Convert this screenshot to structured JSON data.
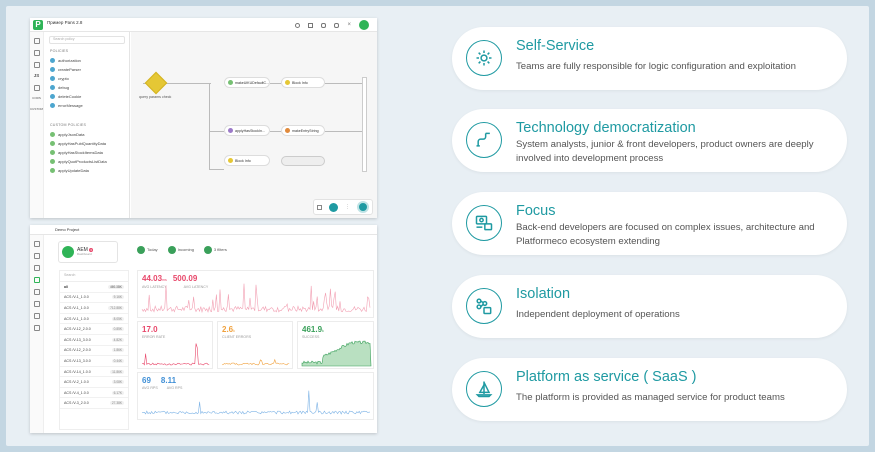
{
  "colors": {
    "accent": "#1f9aa2",
    "brand": "#2fb457",
    "pink": "#e8476a",
    "orange": "#f0a03c",
    "green": "#3aa05a",
    "blue": "#3f8fd6"
  },
  "editor": {
    "app_title": "Пример Pans 2.8",
    "search_placeholder": "Search policy",
    "policies_header": "POLICIES",
    "policies": [
      "authorization",
      "createParser",
      "crypto",
      "debug",
      "deleteCookie",
      "errorMessage"
    ],
    "custom_header": "CUSTOM POLICIES",
    "custom_policies": [
      "applyJsonData",
      "applyHasPublQuantityData",
      "applyHasStockItemsData",
      "applyQuotProductsListData",
      "applyUpdateData"
    ],
    "rail_labels": [
      "JS",
      "CORS",
      "CUSTOM"
    ],
    "nodes": {
      "query": "query params check",
      "n1": "makeUiKUDefaultC...",
      "n2": "Block Info",
      "n3": "applyHasStockIn...",
      "n4": "makeEntryString",
      "n5": "Block Info"
    }
  },
  "monitor": {
    "project": "Demo Project",
    "aem_label": "AEM",
    "aem_badge": "3",
    "dashboard": "Dashboard",
    "filter_today": "Today",
    "filter_incoming": "Incoming",
    "filter_filters": "3 filters",
    "search_placeholder": "Search",
    "all_label": "all",
    "all_count": "460.38K",
    "rows": [
      {
        "name": "ACS /V-1_1.0.0",
        "val": "9.16K"
      },
      {
        "name": "ACS /V-1_1.0.0",
        "val": "712.88K"
      },
      {
        "name": "ACS /V-1_1.0.0",
        "val": "8.05K"
      },
      {
        "name": "ACS /V-12_2.0.0",
        "val": "0.85K"
      },
      {
        "name": "ACS /V-13_3.0.0",
        "val": "4.82K"
      },
      {
        "name": "ACS /V-12_2.0.0",
        "val": "1.86K"
      },
      {
        "name": "ACS /V-13_3.0.0",
        "val": "0.44K"
      },
      {
        "name": "ACS /V-14_1.0.0",
        "val": "11.86K"
      },
      {
        "name": "ACS /V-2_1.0.0",
        "val": "3.08K"
      },
      {
        "name": "ACS /V-4_1.0.0",
        "val": "6.17K"
      },
      {
        "name": "ACS /V-3_2.0.0",
        "val": "27.38K"
      }
    ],
    "metric1_a": "44.03",
    "metric1_a_unit": "ms",
    "metric1_b": "500.09",
    "metric1_a_tip": "AVG LATENCY",
    "metric1_b_tip": "AVG LATENCY",
    "metric2": "17.0",
    "metric2_tip": "ERROR RATE",
    "metric3": "2.6",
    "metric3_unit": "k",
    "metric3_tip": "CLIENT ERRORS",
    "metric4": "461.9",
    "metric4_unit": "k",
    "metric4_tip": "SUCCESS",
    "metric5_a": "69",
    "metric5_b": "8.11",
    "metric5_a_tip": "AVG RPS",
    "metric5_b_tip": "AVG RPS"
  },
  "features": [
    {
      "icon": "gears-icon",
      "title": "Self-Service",
      "desc": "Teams are fully responsible for logic configuration and exploitation"
    },
    {
      "icon": "pipe-icon",
      "title": "Technology democratization",
      "desc": "System analysts, junior & front developers, product owners are deeply involved into development process"
    },
    {
      "icon": "developer-icon",
      "title": "Focus",
      "desc": "Back-end developers are focused on complex issues, architecture and Platformeco ecosystem extending"
    },
    {
      "icon": "deploy-icon",
      "title": "Isolation",
      "desc": "Independent deployment of operations"
    },
    {
      "icon": "sailboat-icon",
      "title": "Platform as service ( SaaS )",
      "desc": "The platform is provided as managed service for product teams"
    }
  ]
}
